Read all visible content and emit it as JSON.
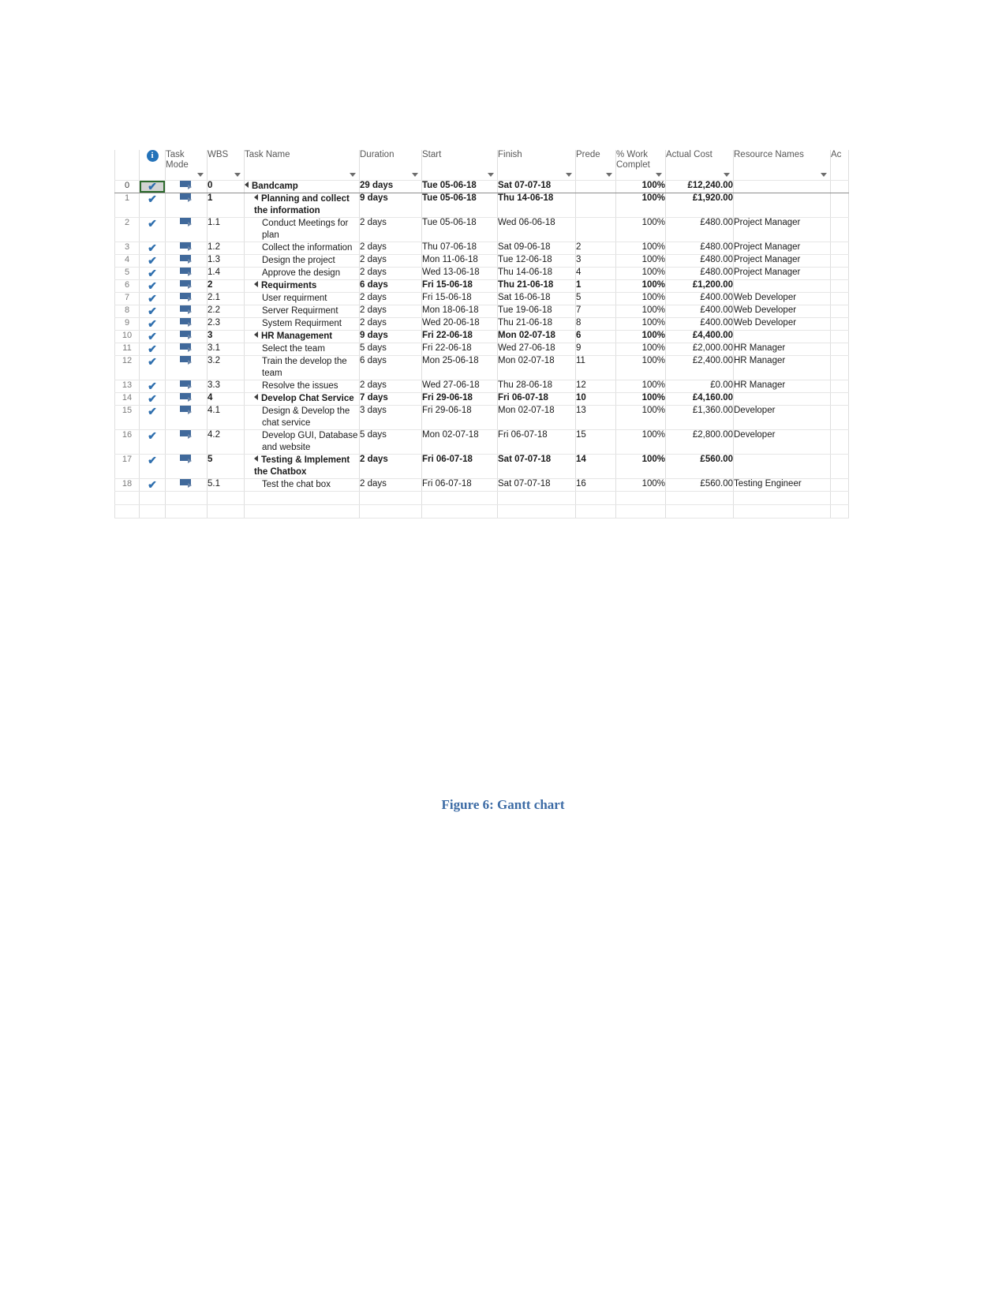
{
  "figure": {
    "caption": "Figure 6: Gantt chart",
    "caption_color": "#3c6ba5"
  },
  "table": {
    "columns": [
      {
        "key": "rownum",
        "label": "",
        "caret": false
      },
      {
        "key": "info",
        "label": "info-icon",
        "caret": false
      },
      {
        "key": "mode",
        "label": "Task Mode",
        "caret": true
      },
      {
        "key": "wbs",
        "label": "WBS",
        "caret": true
      },
      {
        "key": "name",
        "label": "Task Name",
        "caret": true
      },
      {
        "key": "duration",
        "label": "Duration",
        "caret": true
      },
      {
        "key": "start",
        "label": "Start",
        "caret": true
      },
      {
        "key": "finish",
        "label": "Finish",
        "caret": true
      },
      {
        "key": "pred",
        "label": "Prede",
        "caret": true
      },
      {
        "key": "pct",
        "label": "% Work Complet",
        "caret": true
      },
      {
        "key": "cost",
        "label": "Actual Cost",
        "caret": true
      },
      {
        "key": "res",
        "label": "Resource Names",
        "caret": true
      },
      {
        "key": "extra",
        "label": "Ac",
        "caret": false
      }
    ],
    "rows": [
      {
        "id": "0",
        "indicator": "check",
        "mode": "auto-scheduled-icon",
        "wbs": "0",
        "name": "Bandcamp",
        "indent": 0,
        "summary": true,
        "collapse": true,
        "duration": "29 days",
        "start": "Tue 05-06-18",
        "finish": "Sat 07-07-18",
        "pred": "",
        "pct": "100%",
        "cost": "£12,240.00",
        "res": "",
        "selected": true
      },
      {
        "id": "1",
        "indicator": "check",
        "mode": "auto-scheduled-icon",
        "wbs": "1",
        "name": "Planning and collect the information",
        "indent": 1,
        "summary": true,
        "collapse": true,
        "duration": "9 days",
        "start": "Tue 05-06-18",
        "finish": "Thu 14-06-18",
        "pred": "",
        "pct": "100%",
        "cost": "£1,920.00",
        "res": ""
      },
      {
        "id": "2",
        "indicator": "check",
        "mode": "auto-scheduled-icon",
        "wbs": "1.1",
        "name": "Conduct Meetings for plan",
        "indent": 2,
        "summary": false,
        "collapse": false,
        "duration": "2 days",
        "start": "Tue 05-06-18",
        "finish": "Wed 06-06-18",
        "pred": "",
        "pct": "100%",
        "cost": "£480.00",
        "res": "Project Manager"
      },
      {
        "id": "3",
        "indicator": "check",
        "mode": "auto-scheduled-icon",
        "wbs": "1.2",
        "name": "Collect the information",
        "indent": 2,
        "summary": false,
        "collapse": false,
        "duration": "2 days",
        "start": "Thu 07-06-18",
        "finish": "Sat 09-06-18",
        "pred": "2",
        "pct": "100%",
        "cost": "£480.00",
        "res": "Project Manager"
      },
      {
        "id": "4",
        "indicator": "check",
        "mode": "auto-scheduled-icon",
        "wbs": "1.3",
        "name": "Design the project",
        "indent": 2,
        "summary": false,
        "collapse": false,
        "duration": "2 days",
        "start": "Mon 11-06-18",
        "finish": "Tue 12-06-18",
        "pred": "3",
        "pct": "100%",
        "cost": "£480.00",
        "res": "Project Manager"
      },
      {
        "id": "5",
        "indicator": "check",
        "mode": "auto-scheduled-icon",
        "wbs": "1.4",
        "name": "Approve the design",
        "indent": 2,
        "summary": false,
        "collapse": false,
        "duration": "2 days",
        "start": "Wed 13-06-18",
        "finish": "Thu 14-06-18",
        "pred": "4",
        "pct": "100%",
        "cost": "£480.00",
        "res": "Project Manager"
      },
      {
        "id": "6",
        "indicator": "check",
        "mode": "auto-scheduled-icon",
        "wbs": "2",
        "name": "Requirments",
        "indent": 1,
        "summary": true,
        "collapse": true,
        "duration": "6 days",
        "start": "Fri 15-06-18",
        "finish": "Thu 21-06-18",
        "pred": "1",
        "pct": "100%",
        "cost": "£1,200.00",
        "res": ""
      },
      {
        "id": "7",
        "indicator": "check",
        "mode": "auto-scheduled-icon",
        "wbs": "2.1",
        "name": "User requirment",
        "indent": 2,
        "summary": false,
        "collapse": false,
        "duration": "2 days",
        "start": "Fri 15-06-18",
        "finish": "Sat 16-06-18",
        "pred": "5",
        "pct": "100%",
        "cost": "£400.00",
        "res": "Web Developer"
      },
      {
        "id": "8",
        "indicator": "check",
        "mode": "auto-scheduled-icon",
        "wbs": "2.2",
        "name": "Server Requirment",
        "indent": 2,
        "summary": false,
        "collapse": false,
        "duration": "2 days",
        "start": "Mon 18-06-18",
        "finish": "Tue 19-06-18",
        "pred": "7",
        "pct": "100%",
        "cost": "£400.00",
        "res": "Web Developer"
      },
      {
        "id": "9",
        "indicator": "check",
        "mode": "auto-scheduled-icon",
        "wbs": "2.3",
        "name": "System Requirment",
        "indent": 2,
        "summary": false,
        "collapse": false,
        "duration": "2 days",
        "start": "Wed 20-06-18",
        "finish": "Thu 21-06-18",
        "pred": "8",
        "pct": "100%",
        "cost": "£400.00",
        "res": "Web Developer"
      },
      {
        "id": "10",
        "indicator": "check",
        "mode": "auto-scheduled-icon",
        "wbs": "3",
        "name": "HR Management",
        "indent": 1,
        "summary": true,
        "collapse": true,
        "duration": "9 days",
        "start": "Fri 22-06-18",
        "finish": "Mon 02-07-18",
        "pred": "6",
        "pct": "100%",
        "cost": "£4,400.00",
        "res": ""
      },
      {
        "id": "11",
        "indicator": "check",
        "mode": "auto-scheduled-icon",
        "wbs": "3.1",
        "name": "Select the team",
        "indent": 2,
        "summary": false,
        "collapse": false,
        "duration": "5 days",
        "start": "Fri 22-06-18",
        "finish": "Wed 27-06-18",
        "pred": "9",
        "pct": "100%",
        "cost": "£2,000.00",
        "res": "HR Manager"
      },
      {
        "id": "12",
        "indicator": "check",
        "mode": "auto-scheduled-icon",
        "wbs": "3.2",
        "name": "Train the develop the team",
        "indent": 2,
        "summary": false,
        "collapse": false,
        "duration": "6 days",
        "start": "Mon 25-06-18",
        "finish": "Mon 02-07-18",
        "pred": "11",
        "pct": "100%",
        "cost": "£2,400.00",
        "res": "HR Manager"
      },
      {
        "id": "13",
        "indicator": "check",
        "mode": "auto-scheduled-icon",
        "wbs": "3.3",
        "name": "Resolve the issues",
        "indent": 2,
        "summary": false,
        "collapse": false,
        "duration": "2 days",
        "start": "Wed 27-06-18",
        "finish": "Thu 28-06-18",
        "pred": "12",
        "pct": "100%",
        "cost": "£0.00",
        "res": "HR Manager"
      },
      {
        "id": "14",
        "indicator": "check",
        "mode": "auto-scheduled-icon",
        "wbs": "4",
        "name": "Develop Chat Service",
        "indent": 1,
        "summary": true,
        "collapse": true,
        "duration": "7 days",
        "start": "Fri 29-06-18",
        "finish": "Fri 06-07-18",
        "pred": "10",
        "pct": "100%",
        "cost": "£4,160.00",
        "res": ""
      },
      {
        "id": "15",
        "indicator": "check",
        "mode": "auto-scheduled-icon",
        "wbs": "4.1",
        "name": "Design & Develop the chat service",
        "indent": 2,
        "summary": false,
        "collapse": false,
        "duration": "3 days",
        "start": "Fri 29-06-18",
        "finish": "Mon 02-07-18",
        "pred": "13",
        "pct": "100%",
        "cost": "£1,360.00",
        "res": "Developer"
      },
      {
        "id": "16",
        "indicator": "check",
        "mode": "auto-scheduled-icon",
        "wbs": "4.2",
        "name": "Develop GUI, Database and website",
        "indent": 2,
        "summary": false,
        "collapse": false,
        "duration": "5 days",
        "start": "Mon 02-07-18",
        "finish": "Fri 06-07-18",
        "pred": "15",
        "pct": "100%",
        "cost": "£2,800.00",
        "res": "Developer"
      },
      {
        "id": "17",
        "indicator": "check",
        "mode": "auto-scheduled-icon",
        "wbs": "5",
        "name": "Testing & Implement the Chatbox",
        "indent": 1,
        "summary": true,
        "collapse": true,
        "duration": "2 days",
        "start": "Fri 06-07-18",
        "finish": "Sat 07-07-18",
        "pred": "14",
        "pct": "100%",
        "cost": "£560.00",
        "res": ""
      },
      {
        "id": "18",
        "indicator": "check",
        "mode": "auto-scheduled-icon",
        "wbs": "5.1",
        "name": "Test the chat box",
        "indent": 2,
        "summary": false,
        "collapse": false,
        "duration": "2 days",
        "start": "Fri 06-07-18",
        "finish": "Sat 07-07-18",
        "pred": "16",
        "pct": "100%",
        "cost": "£560.00",
        "res": "Testing Engineer"
      }
    ]
  },
  "colors": {
    "header_bg": "#efefef",
    "rownum_bg": "#e4e4e4",
    "check_blue": "#2f6fae",
    "mode_icon_blue": "#40699b",
    "selection_border": "#2e6b2e",
    "caption_blue": "#3c6ba5"
  }
}
